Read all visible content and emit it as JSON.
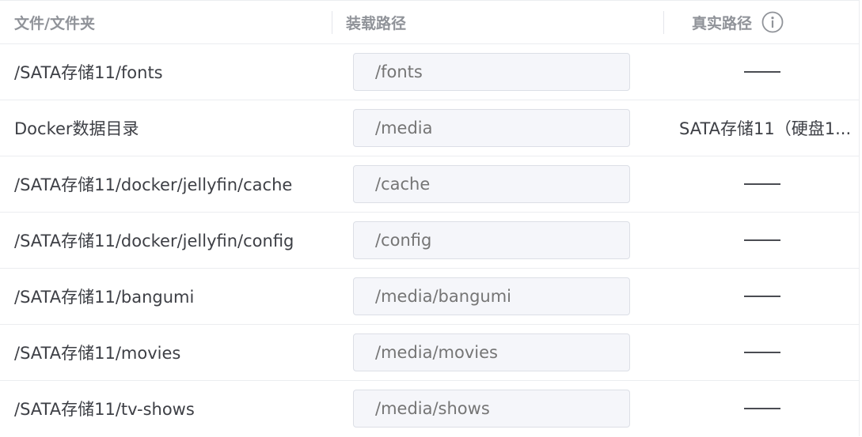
{
  "table": {
    "headers": {
      "file": "文件/文件夹",
      "mount": "装载路径",
      "real": "真实路径"
    },
    "rows": [
      {
        "file": "/SATA存储11/fonts",
        "mount": "/fonts",
        "real": ""
      },
      {
        "file": "Docker数据目录",
        "mount": "/media",
        "real": "SATA存储11（硬盘1..."
      },
      {
        "file": "/SATA存储11/docker/jellyfin/cache",
        "mount": "/cache",
        "real": ""
      },
      {
        "file": "/SATA存储11/docker/jellyfin/config",
        "mount": "/config",
        "real": ""
      },
      {
        "file": "/SATA存储11/bangumi",
        "mount": "/media/bangumi",
        "real": ""
      },
      {
        "file": "/SATA存储11/movies",
        "mount": "/media/movies",
        "real": ""
      },
      {
        "file": "/SATA存储11/tv-shows",
        "mount": "/media/shows",
        "real": ""
      }
    ]
  },
  "icons": {
    "header_info": "info-circle-icon"
  },
  "colors": {
    "header_text": "#909399",
    "body_text": "#3d3f45",
    "input_bg": "#f5f6fa",
    "input_text": "#c0c4cc",
    "border": "#ebedf0"
  }
}
